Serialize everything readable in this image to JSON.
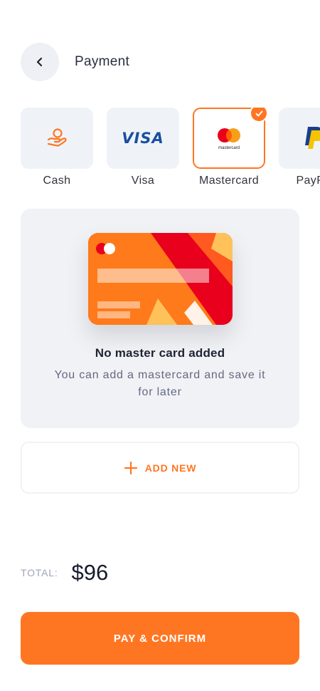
{
  "header": {
    "title": "Payment"
  },
  "methods": [
    {
      "label": "Cash",
      "icon": "cash-icon"
    },
    {
      "label": "Visa",
      "icon": "visa-logo",
      "logo_text": "VISA"
    },
    {
      "label": "Mastercard",
      "icon": "mastercard-logo",
      "logo_text": "mastercard",
      "selected": true
    },
    {
      "label": "PayPal",
      "icon": "paypal-logo"
    }
  ],
  "empty_state": {
    "title": "No master card added",
    "description": "You can add a mastercard and save it for later"
  },
  "add_new": {
    "label": "ADD NEW"
  },
  "total": {
    "label": "TOTAL:",
    "value": "$96"
  },
  "pay_button": {
    "label": "PAY & CONFIRM"
  },
  "colors": {
    "accent": "#ff7622",
    "tile": "#eff3f8",
    "panel": "#f0f2f5"
  }
}
